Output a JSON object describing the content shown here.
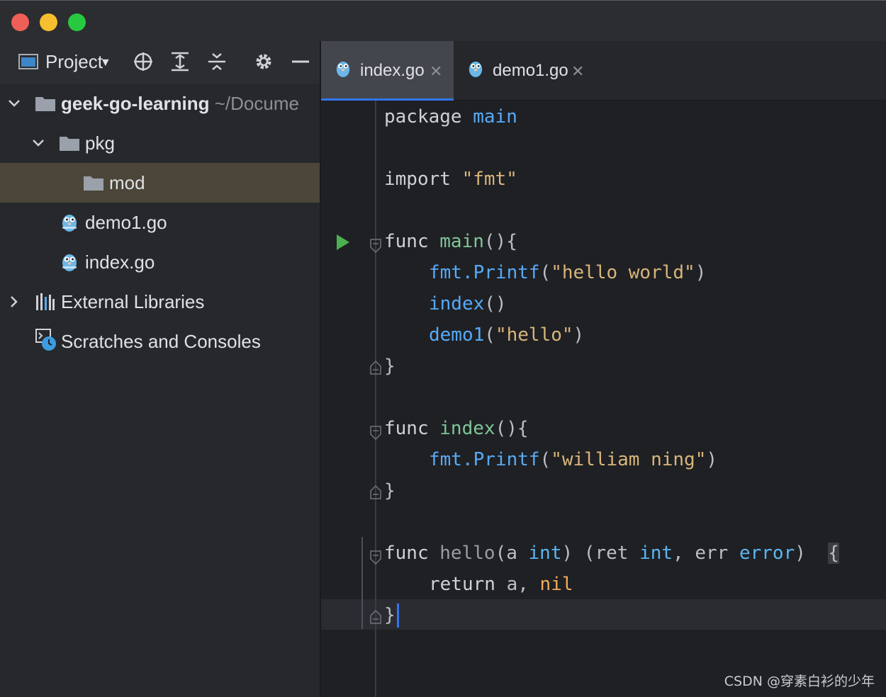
{
  "window": {
    "traffic_lights": [
      "close",
      "minimize",
      "maximize"
    ]
  },
  "sidebar": {
    "toolbar": {
      "project_label": "Project",
      "icons": [
        "dropdown-arrow-icon",
        "locate-icon",
        "expand-all-icon",
        "collapse-all-icon",
        "gear-icon",
        "minimize-icon"
      ]
    },
    "tree": [
      {
        "label": "geek-go-learning",
        "path": "~/Docume",
        "type": "folder",
        "expanded": true
      },
      {
        "label": "pkg",
        "type": "folder",
        "expanded": true
      },
      {
        "label": "mod",
        "type": "folder",
        "selected": true
      },
      {
        "label": "demo1.go",
        "type": "go-file"
      },
      {
        "label": "index.go",
        "type": "go-file"
      },
      {
        "label": "External Libraries",
        "type": "libraries",
        "expanded": false
      },
      {
        "label": "Scratches and Consoles",
        "type": "scratches"
      }
    ]
  },
  "editor": {
    "tabs": [
      {
        "label": "index.go",
        "active": true
      },
      {
        "label": "demo1.go",
        "active": false
      }
    ],
    "code": {
      "l1_kw": "package",
      "l1_name": "main",
      "l3_kw": "import",
      "l3_str": "\"fmt\"",
      "l5_kw": "func",
      "l5_name": "main",
      "l5_rest": "(){",
      "l6_pkg": "fmt.",
      "l6_fn": "Printf",
      "l6_open": "(",
      "l6_str": "\"hello world\"",
      "l6_close": ")",
      "l7_fn": "index",
      "l7_rest": "()",
      "l8_fn": "demo1",
      "l8_open": "(",
      "l8_str": "\"hello\"",
      "l8_close": ")",
      "l9": "}",
      "l11_kw": "func",
      "l11_name": "index",
      "l11_rest": "(){",
      "l12_pkg": "fmt.",
      "l12_fn": "Printf",
      "l12_open": "(",
      "l12_str": "\"william ning\"",
      "l12_close": ")",
      "l13": "}",
      "l15_kw": "func",
      "l15_name": "hello",
      "l15_p1": "(a ",
      "l15_t1": "int",
      "l15_p2": ") (ret ",
      "l15_t2": "int",
      "l15_p3": ", err ",
      "l15_t3": "error",
      "l15_p4": ")  ",
      "l15_brace": "{",
      "l16_kw": "return",
      "l16_mid": " a, ",
      "l16_nil": "nil",
      "l17": "}"
    }
  },
  "watermark": "CSDN @穿素白衫的少年",
  "colors": {
    "accent": "#3574f0",
    "selection": "#4b4639",
    "run": "#4caf50"
  }
}
